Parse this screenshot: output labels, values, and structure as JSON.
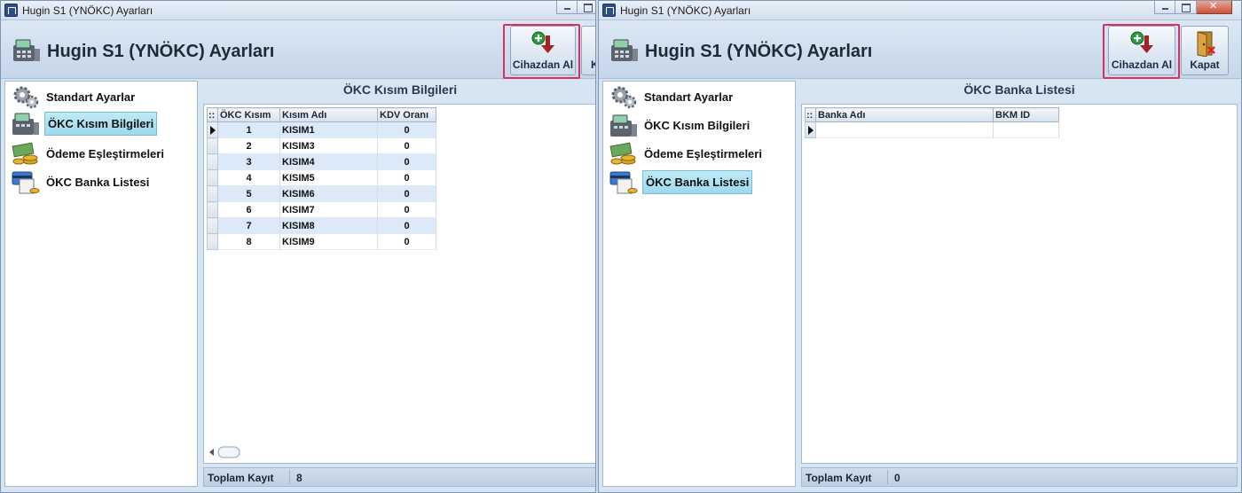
{
  "left_window": {
    "title": "Hugin S1 (YNÖKC) Ayarları",
    "header_title": "Hugin S1 (YNÖKC) Ayarları",
    "toolbar": {
      "fetch_label": "Cihazdan Al",
      "close_label": "K"
    },
    "nav": [
      {
        "label": "Standart Ayarlar",
        "icon": "gears-icon"
      },
      {
        "label": "ÖKC Kısım Bilgileri",
        "icon": "cash-register-icon",
        "selected": true
      },
      {
        "label": "Ödeme Eşleştirmeleri",
        "icon": "money-coins-icon"
      },
      {
        "label": "ÖKC Banka Listesi",
        "icon": "credit-card-icon"
      }
    ],
    "content_title": "ÖKC Kısım Bilgileri",
    "grid": {
      "columns": [
        "ÖKC Kısım",
        "Kısım Adı",
        "KDV Oranı"
      ],
      "rows": [
        [
          "1",
          "KISIM1",
          "0"
        ],
        [
          "2",
          "KISIM3",
          "0"
        ],
        [
          "3",
          "KISIM4",
          "0"
        ],
        [
          "4",
          "KISIM5",
          "0"
        ],
        [
          "5",
          "KISIM6",
          "0"
        ],
        [
          "6",
          "KISIM7",
          "0"
        ],
        [
          "7",
          "KISIM8",
          "0"
        ],
        [
          "8",
          "KISIM9",
          "0"
        ]
      ]
    },
    "status": {
      "label": "Toplam Kayıt",
      "value": "8"
    }
  },
  "right_window": {
    "title": "Hugin S1 (YNÖKC) Ayarları",
    "header_title": "Hugin S1 (YNÖKC) Ayarları",
    "toolbar": {
      "fetch_label": "Cihazdan Al",
      "close_label": "Kapat"
    },
    "nav": [
      {
        "label": "Standart Ayarlar",
        "icon": "gears-icon"
      },
      {
        "label": "ÖKC Kısım Bilgileri",
        "icon": "cash-register-icon"
      },
      {
        "label": "Ödeme Eşleştirmeleri",
        "icon": "money-coins-icon"
      },
      {
        "label": "ÖKC Banka Listesi",
        "icon": "credit-card-icon",
        "selected": true
      }
    ],
    "content_title": "ÖKC Banka Listesi",
    "grid": {
      "columns": [
        "Banka Adı",
        "BKM ID"
      ],
      "rows": []
    },
    "status": {
      "label": "Toplam Kayıt",
      "value": "0"
    }
  },
  "colors": {
    "highlight_border": "#d6315e",
    "selected_nav": "#9ed9ee",
    "alt_row": "#dbe9f8"
  }
}
